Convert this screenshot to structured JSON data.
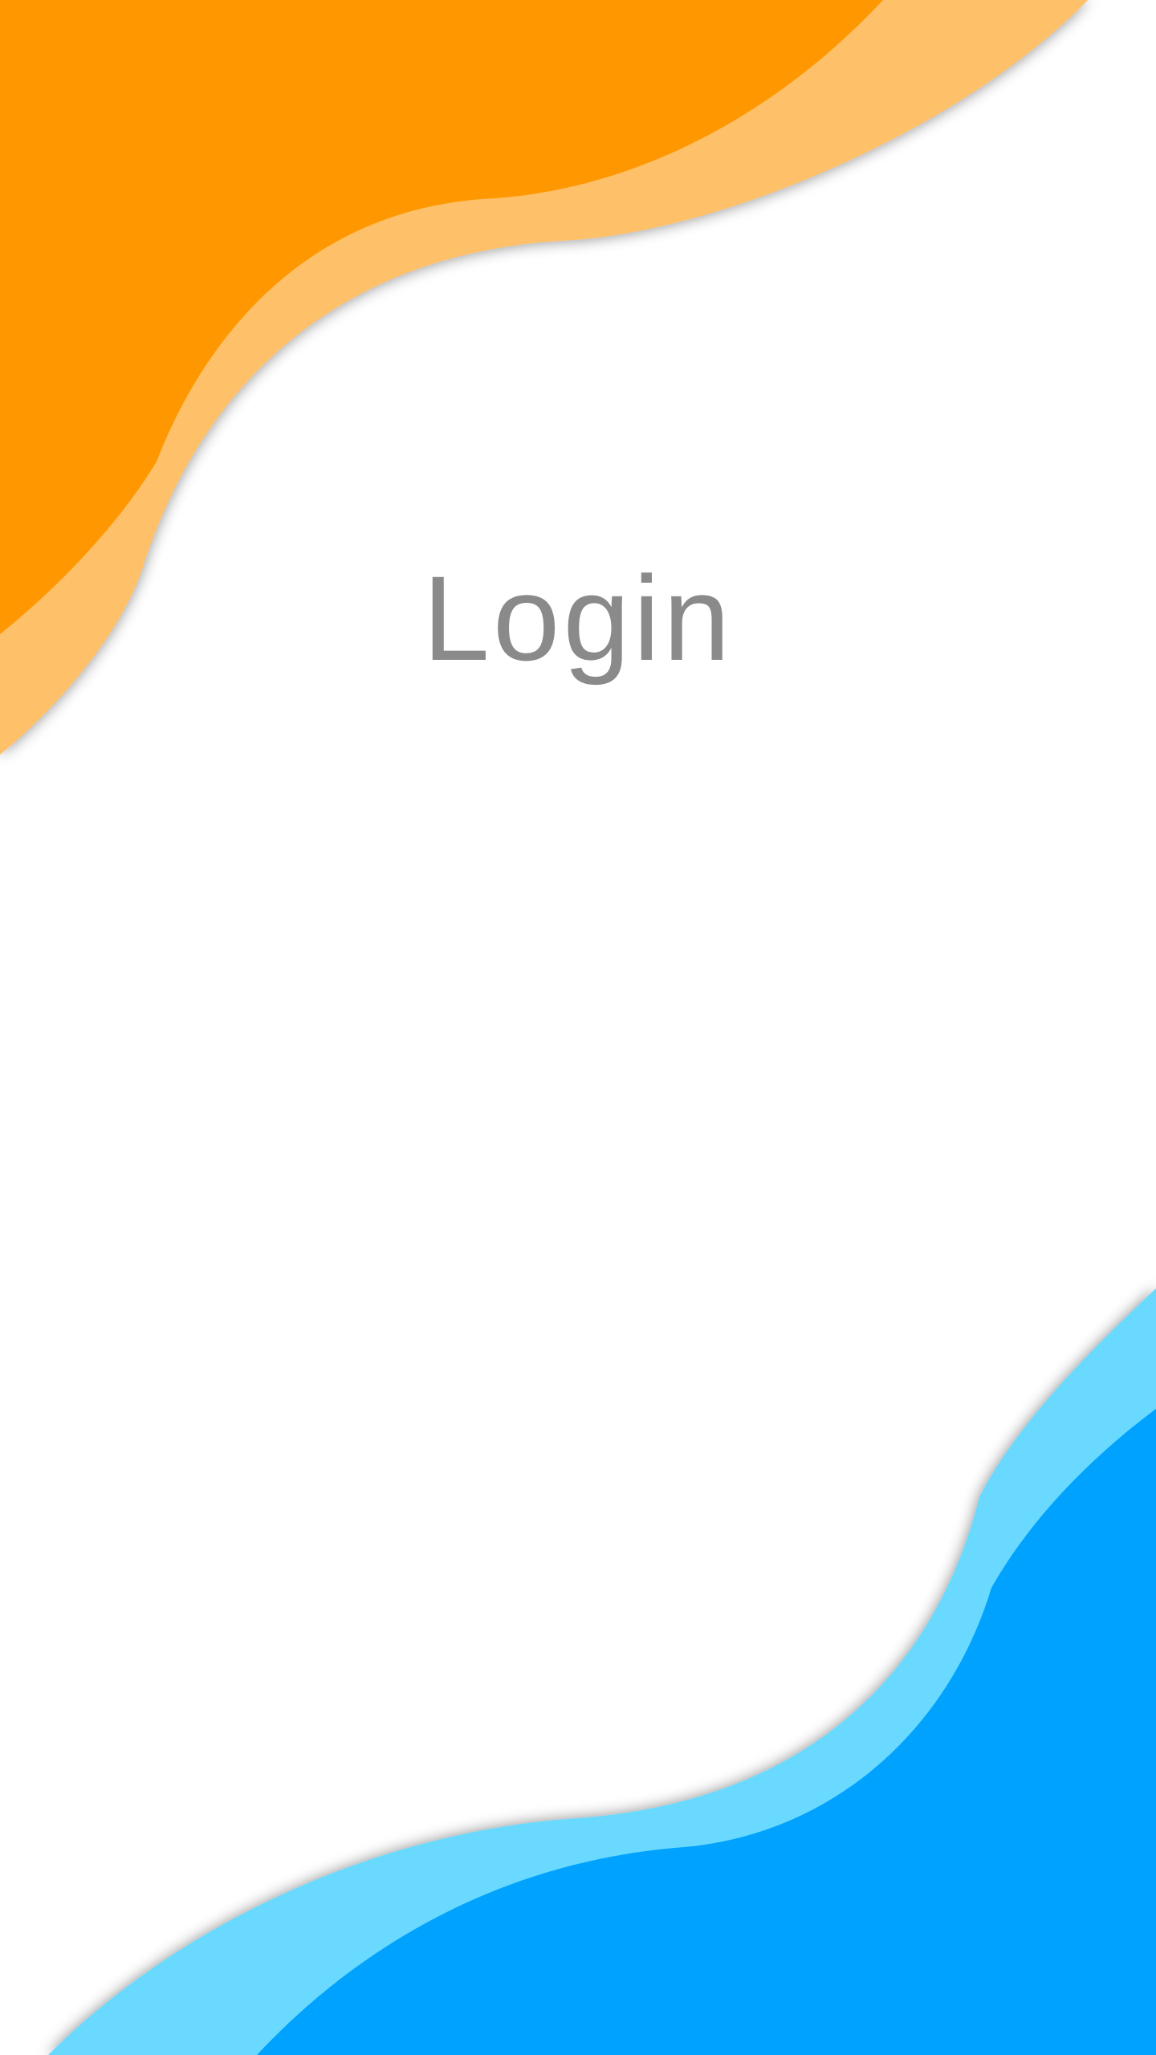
{
  "screen": {
    "title": "Login"
  },
  "colors": {
    "top_wave_light": "#FFC06A",
    "top_wave_dark": "#FF9800",
    "bottom_wave_light": "#6AD9FF",
    "bottom_wave_dark": "#00A2FF",
    "title_text": "#8A8A8A",
    "background": "#FFFFFF"
  }
}
